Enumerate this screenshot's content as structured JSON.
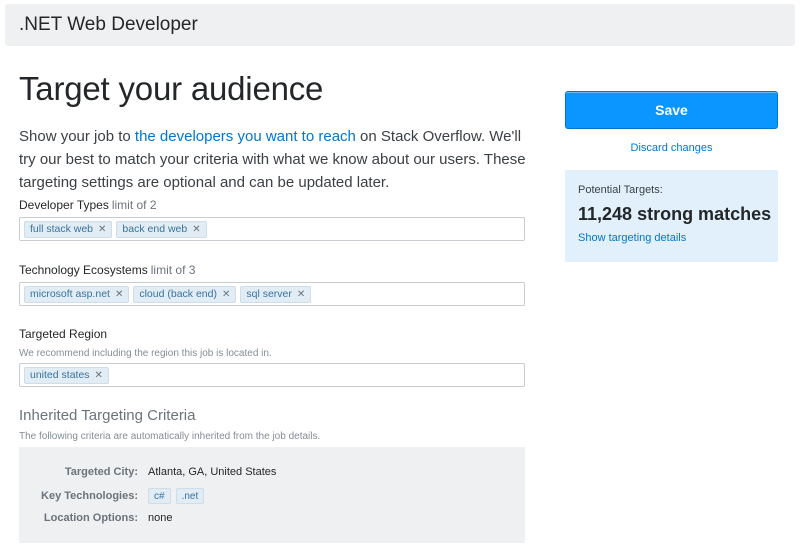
{
  "header": {
    "title": ".NET Web Developer"
  },
  "main": {
    "title": "Target your audience",
    "intro": {
      "before": "Show your job to ",
      "link": "the developers you want to reach",
      "after": " on Stack Overflow. We'll try our best to match your criteria with what we know about our users. These targeting settings are optional and can be updated later."
    },
    "developer_types": {
      "label": "Developer Types",
      "limit": "limit of 2",
      "tags": [
        "full stack web",
        "back end web"
      ]
    },
    "technology_ecosystems": {
      "label": "Technology Ecosystems",
      "limit": "limit of 3",
      "tags": [
        "microsoft asp.net",
        "cloud (back end)",
        "sql server"
      ]
    },
    "targeted_region": {
      "label": "Targeted Region",
      "note": "We recommend including the region this job is located in.",
      "tags": [
        "united states"
      ]
    },
    "inherited": {
      "title": "Inherited Targeting Criteria",
      "description": "The following criteria are automatically inherited from the job details.",
      "city_label": "Targeted City:",
      "city_value": "Atlanta, GA, United States",
      "tech_label": "Key Technologies:",
      "tech_tags": [
        "c#",
        ".net"
      ],
      "location_label": "Location Options:",
      "location_value": "none"
    }
  },
  "sidebar": {
    "save_label": "Save",
    "discard_label": "Discard changes",
    "targets_label": "Potential Targets:",
    "targets_count": "11,248 strong matches",
    "targets_link": "Show targeting details"
  },
  "icons": {
    "tag_remove": "close-icon"
  },
  "colors": {
    "accent": "#0a95ff",
    "link": "#0077cc",
    "tag_bg": "#e1ecf4",
    "tag_text": "#39739d",
    "targets_bg": "#e1f0fb"
  }
}
